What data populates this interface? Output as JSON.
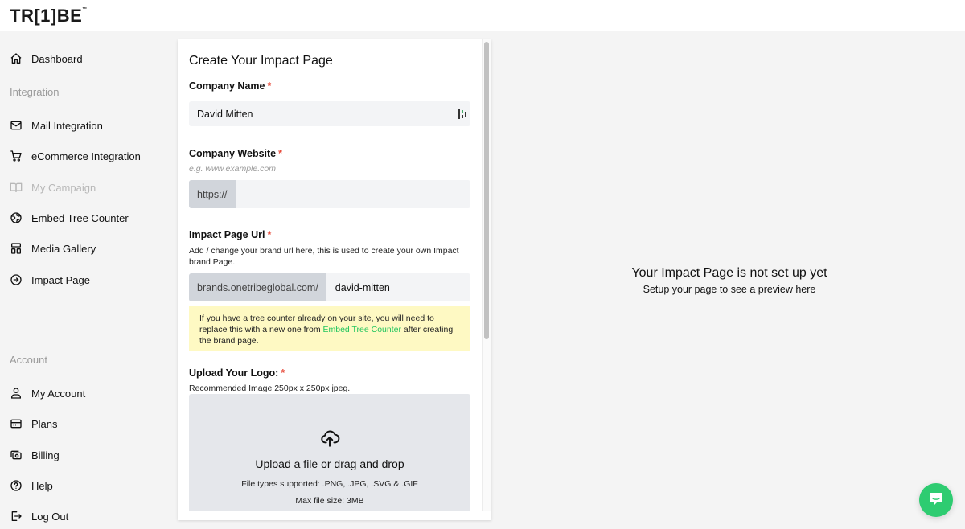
{
  "brand": {
    "logo_text": "TR[1]BE",
    "trademark": "™"
  },
  "sidebar": {
    "items": [
      {
        "label": "Dashboard",
        "icon": "home-icon",
        "disabled": false
      },
      {
        "label": "Mail Integration",
        "icon": "mail-icon",
        "disabled": false
      },
      {
        "label": "eCommerce Integration",
        "icon": "cart-icon",
        "disabled": false
      },
      {
        "label": "My Campaign",
        "icon": "book-icon",
        "disabled": true
      },
      {
        "label": "Embed Tree Counter",
        "icon": "globe-icon",
        "disabled": false
      },
      {
        "label": "Media Gallery",
        "icon": "gallery-icon",
        "disabled": false
      },
      {
        "label": "Impact Page",
        "icon": "arrow-circle-right-icon",
        "disabled": false
      }
    ],
    "sections": {
      "integration": "Integration",
      "account": "Account"
    },
    "account_items": [
      {
        "label": "My Account",
        "icon": "user-icon"
      },
      {
        "label": "Plans",
        "icon": "credit-card-icon"
      },
      {
        "label": "Billing",
        "icon": "cash-icon"
      },
      {
        "label": "Help",
        "icon": "question-circle-icon"
      },
      {
        "label": "Log Out",
        "icon": "logout-icon"
      }
    ]
  },
  "form": {
    "title": "Create Your Impact Page",
    "required_mark": "*",
    "company_name": {
      "label": "Company Name",
      "value": "David Mitten"
    },
    "company_website": {
      "label": "Company Website",
      "hint": "e.g. www.example.com",
      "prefix": "https://",
      "value": ""
    },
    "impact_url": {
      "label": "Impact Page Url",
      "help": "Add / change your brand url here, this is used to create your own Impact brand Page.",
      "prefix": "brands.onetribeglobal.com/",
      "value": "david-mitten"
    },
    "notice": {
      "before": "If you have a tree counter already on your site, you will need to replace this with a new one from ",
      "link": "Embed Tree Counter",
      "after": " after creating the brand page."
    },
    "logo": {
      "label": "Upload Your Logo:",
      "help": "Recommended Image 250px x 250px jpeg.",
      "dropzone_title": "Upload a file or drag and drop",
      "types": "File types supported: .PNG, .JPG, .SVG & .GIF",
      "max_size": "Max file size: 3MB"
    }
  },
  "preview": {
    "title": "Your Impact Page is not set up yet",
    "subtitle": "Setup your page to see a preview here"
  },
  "colors": {
    "accent_green": "#22c55e",
    "required_red": "#e74c3c",
    "notice_bg": "#fef9c3",
    "chat_green": "#2ecc71"
  }
}
